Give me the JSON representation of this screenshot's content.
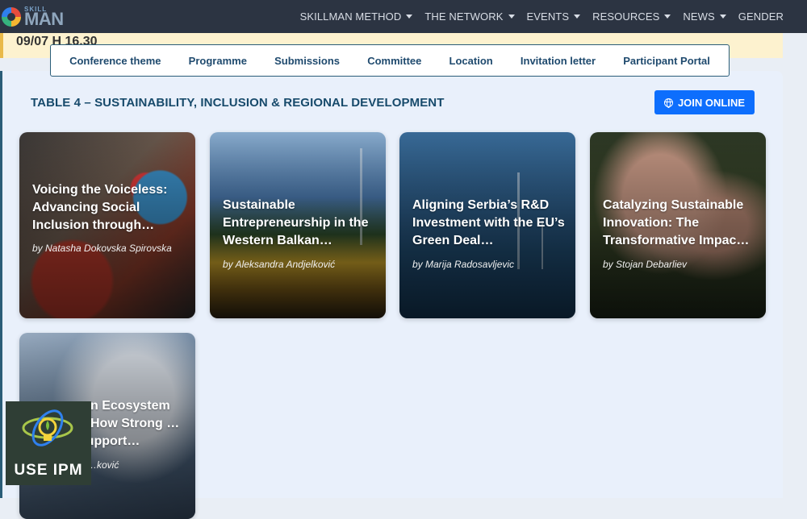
{
  "brand": {
    "small": "SKILL",
    "big": "MAN"
  },
  "nav": [
    {
      "label": "SKILLMAN METHOD",
      "caret": true
    },
    {
      "label": "THE NETWORK",
      "caret": true
    },
    {
      "label": "EVENTS",
      "caret": true
    },
    {
      "label": "RESOURCES",
      "caret": true
    },
    {
      "label": "NEWS",
      "caret": true
    },
    {
      "label": "GENDER",
      "caret": false
    }
  ],
  "notice": {
    "text": "09/07 H 16.30"
  },
  "subnav": [
    "Conference theme",
    "Programme",
    "Submissions",
    "Committee",
    "Location",
    "Invitation letter",
    "Participant Portal"
  ],
  "panel": {
    "title": "TABLE 4 – SUSTAINABILITY, INCLUSION & REGIONAL DEVELOPMENT",
    "join_label": "JOIN ONLINE"
  },
  "cards": [
    {
      "title": "Voicing the Voiceless: Advancing Social Inclusion through…",
      "author": "by Natasha Dokovska Spirovska"
    },
    {
      "title": "Sustainable Entrepreneurship in the Western Balkan…",
      "author": "by Aleksandra Andjelković"
    },
    {
      "title": "Aligning Serbia’s R&D Investment with the EU’s Green Deal…",
      "author": "by Marija Radosavljevic"
    },
    {
      "title": "Catalyzing Sustainable Innovation: The Transformative Impac…",
      "author": "by Stojan Debarliev"
    },
    {
      "title": "…n Ecosystem …How Strong …Support…",
      "author": "…ković"
    }
  ],
  "badge": {
    "text": "USE IPM"
  },
  "colors": {
    "nav_bg": "#2c3442",
    "accent": "#0d6efd",
    "panel_title": "#174a6b",
    "notice_bg": "#fdf2cf"
  }
}
